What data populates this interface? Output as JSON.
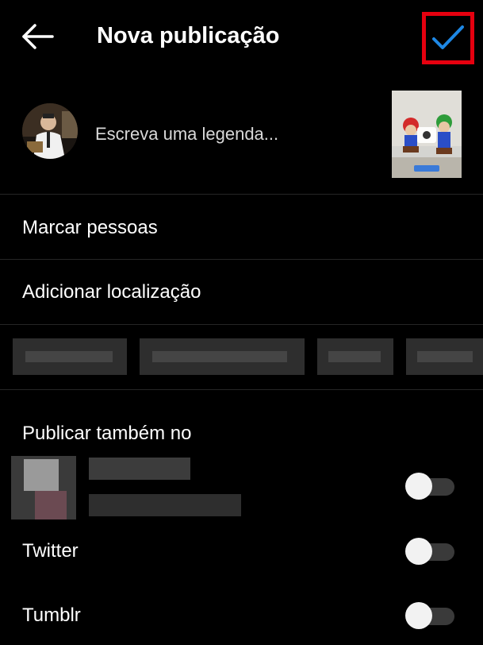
{
  "header": {
    "title": "Nova publicação",
    "back_icon": "arrow-left-icon",
    "confirm_icon": "checkmark-icon",
    "accent_color": "#1e88e5",
    "highlight_color": "#e6000f"
  },
  "caption": {
    "placeholder": "Escreva uma legenda...",
    "value": ""
  },
  "options": {
    "tag_people": "Marcar pessoas",
    "add_location": "Adicionar localização"
  },
  "share": {
    "heading": "Publicar também no",
    "accounts": [
      {
        "label": "Twitter",
        "enabled": false
      },
      {
        "label": "Tumblr",
        "enabled": false
      }
    ],
    "blurred_account_enabled": false
  }
}
